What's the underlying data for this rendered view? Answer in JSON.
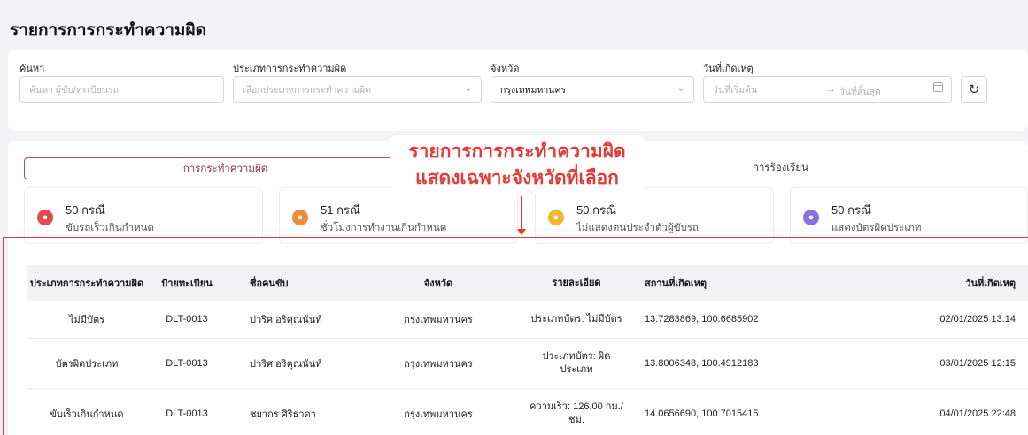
{
  "page": {
    "title": "รายการการกระทำความผิด"
  },
  "filters": {
    "search": {
      "label": "ค้นหา",
      "placeholder": "ค้นหา ผู้ขับ/ทะเบียนรถ"
    },
    "violation_type": {
      "label": "ประเภทการกระทำความผิด",
      "placeholder": "เลือกประเภทการกระทำความผิด"
    },
    "province": {
      "label": "จังหวัด",
      "value": "กรุงเทพมหานคร"
    },
    "date": {
      "label": "วันที่เกิดเหตุ",
      "start_placeholder": "วันที่เริ่มต้น",
      "arrow": "→",
      "end_placeholder": "วันที่สิ้นสุด"
    },
    "refresh_icon": "refresh-icon"
  },
  "tabs": [
    {
      "label": "การกระทำความผิด",
      "active": true
    },
    {
      "label": "การร้องเรียน",
      "active": false
    }
  ],
  "stats": [
    {
      "count": "50 กรณี",
      "description": "ขับรถเร็วเกินกำหนด",
      "color": "#e5484d"
    },
    {
      "count": "51 กรณี",
      "description": "ชั่วโมงการทำงานเกินกำหนด",
      "color": "#f08a3c"
    },
    {
      "count": "50 กรณี",
      "description": "ไม่แสดงตนประจำตัวผู้ขับรถ",
      "color": "#f2b632"
    },
    {
      "count": "50 กรณี",
      "description": "แสดงบัตรผิดประเภท",
      "color": "#8b6fe0"
    }
  ],
  "annotation": {
    "line1": "รายการการกระทำความผิด",
    "line2": "แสดงเฉพาะจังหวัดที่เลือก",
    "color": "#e53935"
  },
  "table": {
    "headers": [
      "ประเภทการกระทำความผิด",
      "ป้ายทะเบียน",
      "ชื่อคนขับ",
      "จังหวัด",
      "รายละเอียด",
      "สถานที่เกิดเหตุ",
      "วันที่เกิดเหตุ"
    ],
    "rows": [
      {
        "type": "ไม่มีบัตร",
        "plate": "DLT-0013",
        "driver": "ปวริศ อริคุณนันท์",
        "province": "กรุงเทพมหานคร",
        "detail": "ประเภทบัตร: ไม่มีบัตร",
        "location": "13.7283869, 100.6685902",
        "datetime": "02/01/2025 13:14"
      },
      {
        "type": "บัตรผิดประเภท",
        "plate": "DLT-0013",
        "driver": "ปวริศ อริคุณนันท์",
        "province": "กรุงเทพมหานคร",
        "detail": "ประเภทบัตร: ผิดประเภท",
        "location": "13.8006348, 100.4912183",
        "datetime": "03/01/2025 12:15"
      },
      {
        "type": "ขับเร็วเกินกำหนด",
        "plate": "DLT-0013",
        "driver": "ชยากร ศิริธาดา",
        "province": "กรุงเทพมหานคร",
        "detail": "ความเร็ว: 126.00 กม./ชม.",
        "location": "14.0656690, 100.7015415",
        "datetime": "04/01/2025 22:48"
      }
    ]
  }
}
